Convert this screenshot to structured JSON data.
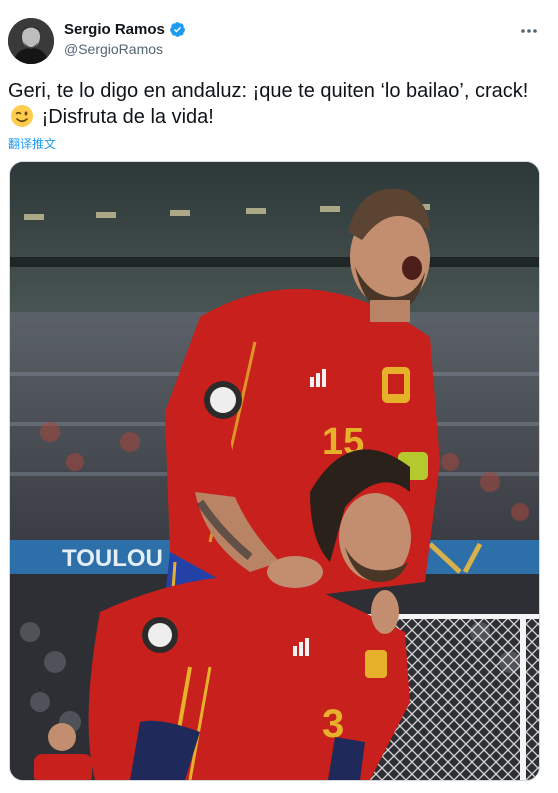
{
  "tweet": {
    "display_name": "Sergio Ramos",
    "handle": "@SergioRamos",
    "text_part1": "Geri, te lo digo en andaluz: ¡que te quiten ‘lo bailao’, crack!",
    "emoji": "winking-face",
    "text_part2": "¡Disfruta de la vida!",
    "translate_label": "翻译推文"
  },
  "media": {
    "banner_text": "TOULOU",
    "player_top_number": "15",
    "player_bottom_number": "3"
  },
  "icons": {
    "verified": "verified-badge-icon",
    "more": "more-options-icon"
  },
  "colors": {
    "accent": "#1d9bf0",
    "jersey_red": "#c8201c",
    "jersey_gold": "#e5b22a"
  }
}
